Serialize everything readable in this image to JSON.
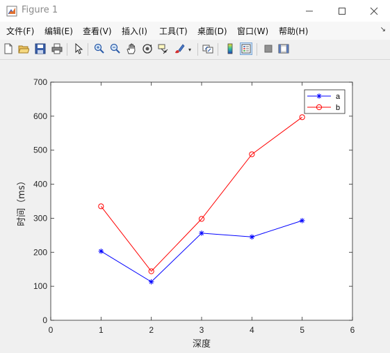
{
  "window": {
    "title": "Figure 1"
  },
  "menu": [
    {
      "label": "文件(F)"
    },
    {
      "label": "编辑(E)"
    },
    {
      "label": "查看(V)"
    },
    {
      "label": "插入(I)"
    },
    {
      "label": "工具(T)"
    },
    {
      "label": "桌面(D)"
    },
    {
      "label": "窗口(W)"
    },
    {
      "label": "帮助(H)"
    }
  ],
  "toolbar": [
    {
      "icon": "new-figure-icon"
    },
    {
      "icon": "open-file-icon"
    },
    {
      "icon": "save-icon"
    },
    {
      "icon": "print-icon"
    },
    {
      "icon": "pointer-icon"
    },
    {
      "icon": "zoom-in-icon"
    },
    {
      "icon": "zoom-out-icon"
    },
    {
      "icon": "pan-hand-icon"
    },
    {
      "icon": "rotate-3d-icon"
    },
    {
      "icon": "data-cursor-icon"
    },
    {
      "icon": "brush-icon"
    },
    {
      "icon": "link-plot-icon"
    },
    {
      "icon": "colorbar-icon"
    },
    {
      "icon": "legend-icon"
    },
    {
      "icon": "hide-plot-tools-icon"
    },
    {
      "icon": "show-plot-tools-icon"
    }
  ],
  "colors": {
    "series_a": "#0000ff",
    "series_b": "#ff0000"
  },
  "chart_data": {
    "type": "line",
    "xlabel": "深度",
    "ylabel": "时间（ms）",
    "xlim": [
      0,
      6
    ],
    "ylim": [
      0,
      700
    ],
    "xticks": [
      "0",
      "1",
      "2",
      "3",
      "4",
      "5",
      "6"
    ],
    "yticks": [
      "0",
      "100",
      "200",
      "300",
      "400",
      "500",
      "600",
      "700"
    ],
    "grid": false,
    "legend_position": "top-right",
    "x": [
      1,
      2,
      3,
      4,
      5
    ],
    "series": [
      {
        "name": "a",
        "marker": "*",
        "color": "#0000ff",
        "values": [
          203,
          113,
          256,
          245,
          293
        ]
      },
      {
        "name": "b",
        "marker": "o",
        "color": "#ff0000",
        "values": [
          335,
          144,
          298,
          488,
          597
        ]
      }
    ]
  }
}
